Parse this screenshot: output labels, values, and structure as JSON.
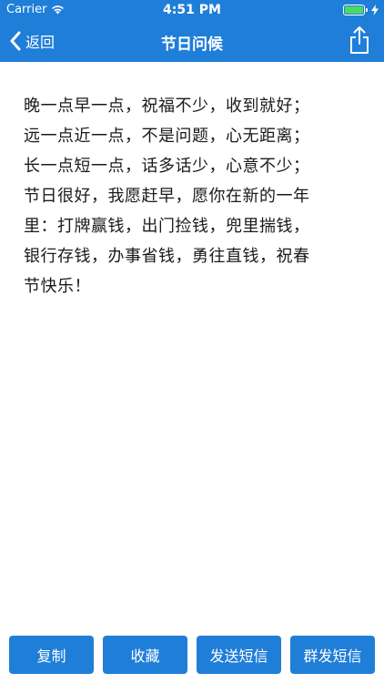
{
  "status_bar": {
    "carrier": "Carrier",
    "time": "4:51 PM",
    "battery_level": 1.0
  },
  "navbar": {
    "back_label": "返回",
    "title": "节日问候",
    "share_icon": "share-icon"
  },
  "message": {
    "lines": [
      "晚一点早一点，祝福不少，收到就好；",
      "远一点近一点，不是问题，心无距离；",
      "长一点短一点，话多话少，心意不少；",
      "节日很好，我愿赶早，愿你在新的一年",
      "里：打牌赢钱，出门捡钱，兜里揣钱，",
      "银行存钱，办事省钱，勇往直钱，祝春",
      "节快乐！"
    ]
  },
  "actions": {
    "copy": "复制",
    "favorite": "收藏",
    "send_sms": "发送短信",
    "group_sms": "群发短信"
  },
  "colors": {
    "accent": "#1f7ed8",
    "battery": "#4cd964"
  }
}
